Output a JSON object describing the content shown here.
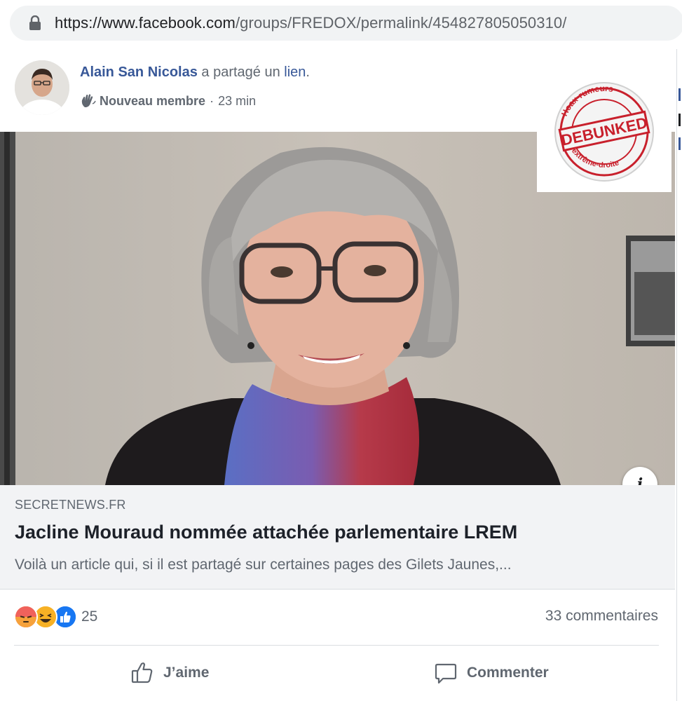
{
  "browser": {
    "url_main": "https://www.facebook.com",
    "url_path": "/groups/FREDOX/permalink/454827805050310/"
  },
  "post": {
    "author": "Alain San Nicolas",
    "action_text": " a partagé un ",
    "link_word": "lien",
    "action_end": ".",
    "badge": "Nouveau membre",
    "separator": "·",
    "time": "23 min"
  },
  "stamp": {
    "center_text": "DEBUNKED",
    "top_arc": "Hoax-rumeurs",
    "bottom_arc": "d'extrême-droite"
  },
  "link_preview": {
    "domain": "SECRETNEWS.FR",
    "headline": "Jacline Mouraud nommée attachée parlementaire LREM",
    "description": "Voilà un article qui, si il est partagé sur certaines pages des Gilets Jaunes,..."
  },
  "engagement": {
    "reaction_count": "25",
    "comments": "33 commentaires"
  },
  "actions": {
    "like": "J’aime",
    "comment": "Commenter"
  },
  "colors": {
    "link_blue": "#385898",
    "angry": "#f0625c",
    "haha": "#f7b125",
    "like": "#1877f2"
  }
}
